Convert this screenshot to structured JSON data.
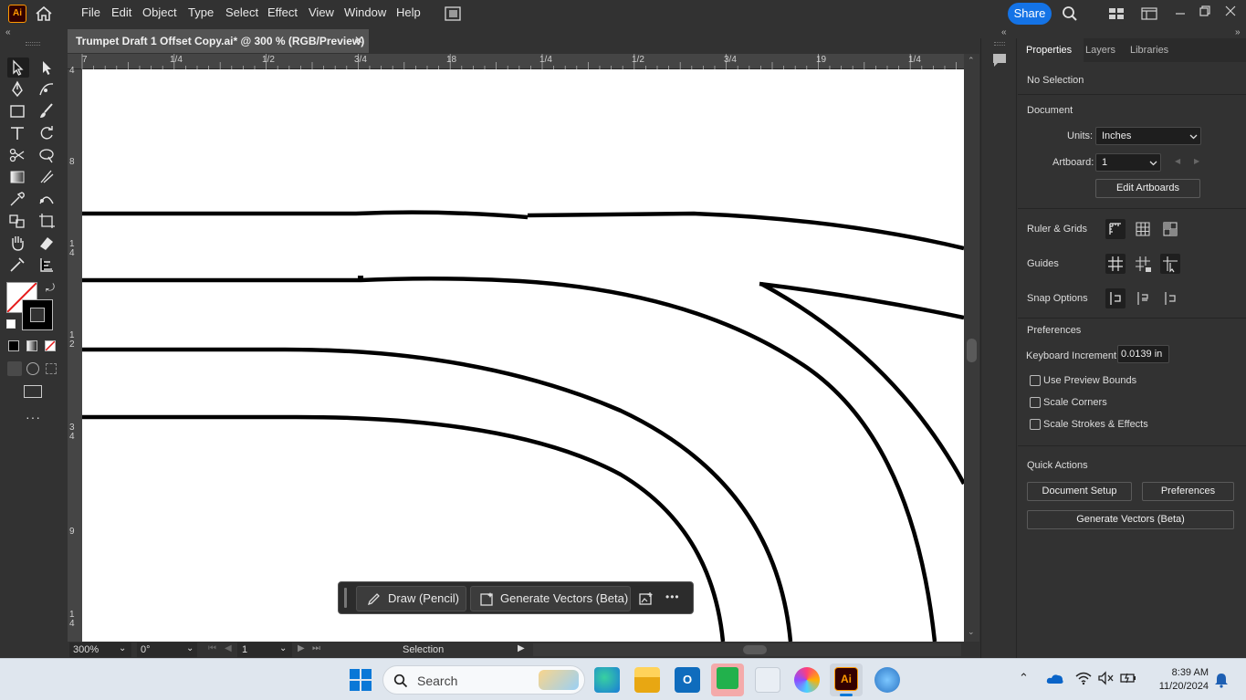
{
  "app": {
    "logo_text": "Ai",
    "menus": [
      "File",
      "Edit",
      "Object",
      "Type",
      "Select",
      "Effect",
      "View",
      "Window",
      "Help"
    ],
    "share_label": "Share"
  },
  "document": {
    "tab_title": "Trumpet Draft 1 Offset Copy.ai* @ 300 % (RGB/Preview)",
    "close_glyph": "✕"
  },
  "rulers": {
    "horizontal_labels": [
      "7",
      "1/4",
      "1/2",
      "3/4",
      "18",
      "1/4",
      "1/2",
      "3/4",
      "19",
      "1/4"
    ],
    "vertical_labels": [
      "4",
      "8",
      "1 4",
      "1 2",
      "3 4",
      "9",
      "1 4"
    ]
  },
  "context_bar": {
    "draw_label": "Draw (Pencil)",
    "generate_label": "Generate Vectors (Beta)",
    "more_glyph": "•••"
  },
  "status": {
    "zoom": "300%",
    "rotation": "0°",
    "artboard": "1",
    "mode": "Selection"
  },
  "panel": {
    "tabs": [
      "Properties",
      "Layers",
      "Libraries"
    ],
    "selection": "No Selection",
    "document_heading": "Document",
    "units_label": "Units:",
    "units_value": "Inches",
    "artboard_label": "Artboard:",
    "artboard_value": "1",
    "edit_artboards": "Edit Artboards",
    "ruler_grids": "Ruler & Grids",
    "guides": "Guides",
    "snap_options": "Snap Options",
    "preferences_heading": "Preferences",
    "keyboard_increment_label": "Keyboard Increment:",
    "keyboard_increment_value": "0.0139 in",
    "use_preview_bounds": "Use Preview Bounds",
    "scale_corners": "Scale Corners",
    "scale_strokes": "Scale Strokes & Effects",
    "quick_actions_heading": "Quick Actions",
    "document_setup": "Document Setup",
    "preferences_button": "Preferences",
    "generate_vectors": "Generate Vectors (Beta)"
  },
  "taskbar": {
    "search_placeholder": "Search",
    "time": "8:39 AM",
    "date": "11/20/2024"
  },
  "colors": {
    "accent": "#1473e6",
    "ai_orange": "#ff9a00"
  }
}
